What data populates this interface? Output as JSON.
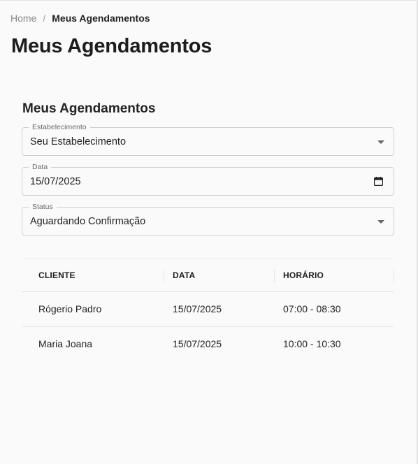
{
  "breadcrumb": {
    "home": "Home",
    "separator": "/",
    "current": "Meus Agendamentos"
  },
  "page": {
    "title": "Meus Agendamentos"
  },
  "section": {
    "title": "Meus Agendamentos"
  },
  "filters": {
    "estabelecimento": {
      "label": "Estabelecimento",
      "value": "Seu Estabelecimento"
    },
    "data": {
      "label": "Data",
      "value": "15/07/2025"
    },
    "status": {
      "label": "Status",
      "value": "Aguardando Confirmação"
    }
  },
  "table": {
    "headers": [
      "CLIENTE",
      "DATA",
      "HORÁRIO"
    ],
    "rows": [
      {
        "cliente": "Rógerio Padro",
        "data": "15/07/2025",
        "horario": "07:00 - 08:30"
      },
      {
        "cliente": "Maria Joana",
        "data": "15/07/2025",
        "horario": "10:00 - 10:30"
      }
    ]
  },
  "icons": {
    "dropdown": "chevron-down-icon",
    "date": "calendar-icon"
  },
  "colors": {
    "background": "#fafafa",
    "text": "#212121",
    "border": "#cfcfcf"
  }
}
